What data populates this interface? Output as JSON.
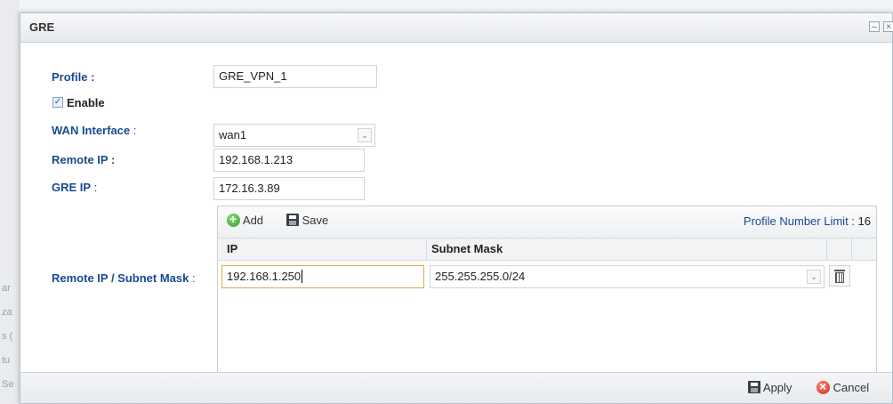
{
  "background": {
    "side_texts": [
      "ar",
      "za",
      "s (",
      "tu",
      "Se"
    ]
  },
  "dialog": {
    "title": "GRE",
    "minimize": "–",
    "close": "×"
  },
  "form": {
    "profile_label": "Profile :",
    "profile_value": "GRE_VPN_1",
    "enable_label": "Enable",
    "enable_checked": true,
    "check_mark": "✓",
    "wan_label": "WAN Interface",
    "wan_colon": " :",
    "wan_value": "wan1",
    "select_arrow": "⌄",
    "remote_ip_label": "Remote IP :",
    "remote_ip_value": "192.168.1.213",
    "gre_ip_label": "GRE IP",
    "gre_ip_colon": " :",
    "gre_ip_value": "172.16.3.89",
    "remote_subnet_label": "Remote IP / Subnet Mask",
    "remote_subnet_colon": " :"
  },
  "table": {
    "add_label": "Add",
    "save_label": "Save",
    "limit_label": "Profile Number Limit :",
    "limit_value": "16",
    "headers": [
      "IP",
      "Subnet Mask"
    ],
    "rows": [
      {
        "ip": "192.168.1.250",
        "mask": "255.255.255.0/24"
      }
    ]
  },
  "footer": {
    "apply_label": "Apply",
    "cancel_label": "Cancel"
  }
}
